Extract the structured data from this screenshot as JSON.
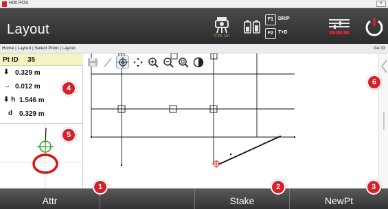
{
  "window": {
    "title": "Hilti POS",
    "close_label": "✕"
  },
  "header": {
    "title": "Layout",
    "instrument_status": "C.M. On",
    "fkeys": [
      {
        "key": "F1",
        "label": "DR/P"
      },
      {
        "key": "F2",
        "label": "T+D"
      }
    ],
    "icons": [
      "instrument-icon",
      "battery-icon",
      "settings-icon",
      "power-icon"
    ]
  },
  "breadcrumb": {
    "path": "Home | Layout | Select Point | Layout",
    "time": "04:33"
  },
  "point": {
    "label": "Pt ID",
    "id": "35",
    "rows": [
      {
        "symbol": "⬇",
        "value": "0.329 m"
      },
      {
        "symbol": "→",
        "value": "0.012 m"
      },
      {
        "symbol": "⬇ h",
        "value": "1.546 m"
      },
      {
        "symbol": "d",
        "value": "0.329 m"
      }
    ]
  },
  "toolbar": {
    "tools": [
      "save-icon",
      "line-tool-icon",
      "target-icon",
      "pan-icon",
      "zoom-in-icon",
      "zoom-out-icon",
      "zoom-fit-icon",
      "contrast-icon"
    ],
    "active": "target-icon"
  },
  "softkeys": [
    "Attr",
    "",
    "Stake",
    "NewPt"
  ],
  "annotations": [
    "1",
    "2",
    "3",
    "4",
    "5",
    "6"
  ],
  "colors": {
    "header": "#2c2c2c",
    "accent": "#d4212b",
    "point_row": "#f3f3c4",
    "status_green": "#5ec640"
  }
}
